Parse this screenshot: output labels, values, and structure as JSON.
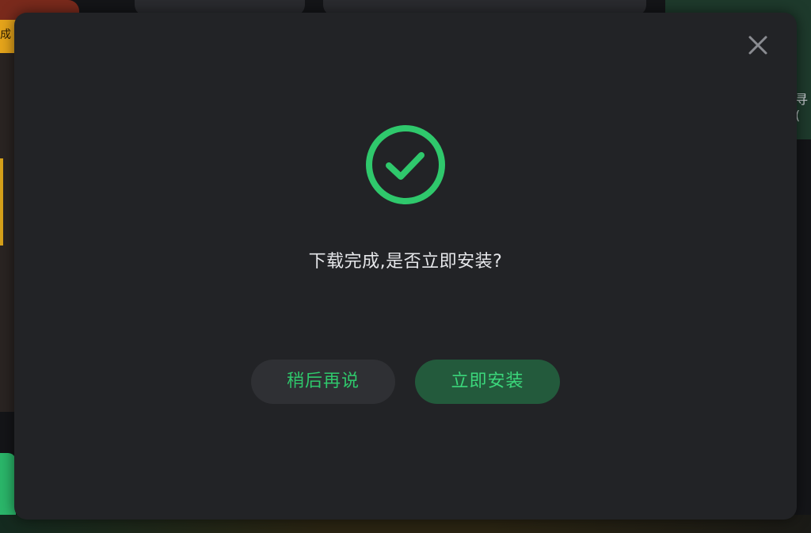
{
  "background": {
    "left_tag_text": "成了",
    "right_partial_text": "寻("
  },
  "dialog": {
    "message": "下载完成,是否立即安装?",
    "icons": {
      "success": "check-circle-icon",
      "close": "close-icon"
    },
    "buttons": {
      "later_label": "稍后再说",
      "install_label": "立即安装"
    },
    "colors": {
      "dialog_bg": "#222326",
      "accent_green": "#2fc86c",
      "install_button_bg": "#235a3c",
      "later_button_bg": "#2f3034",
      "close_icon": "#8a8c91",
      "message_text": "#e6e7ea"
    }
  }
}
